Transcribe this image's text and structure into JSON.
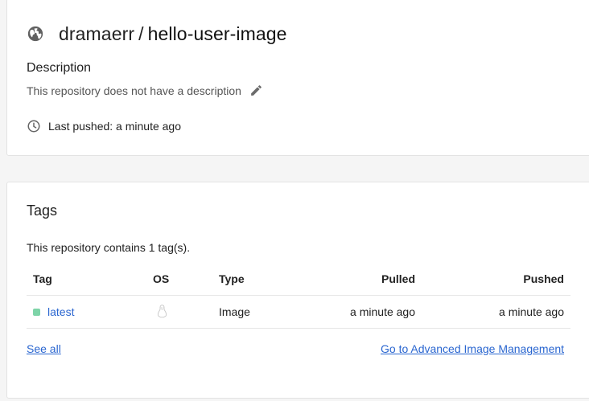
{
  "repo": {
    "owner": "dramaerr",
    "separator": "/",
    "image_name": "hello-user-image",
    "description_heading": "Description",
    "description_text": "This repository does not have a description",
    "last_pushed": "Last pushed: a minute ago"
  },
  "tags": {
    "title": "Tags",
    "summary": "This repository contains 1 tag(s).",
    "columns": {
      "tag": "Tag",
      "os": "OS",
      "type": "Type",
      "pulled": "Pulled",
      "pushed": "Pushed"
    },
    "rows": [
      {
        "tag": "latest",
        "os_icon": "linux-icon",
        "type": "Image",
        "pulled": "a minute ago",
        "pushed": "a minute ago",
        "status_color": "#7ed4a8"
      }
    ],
    "see_all": "See all",
    "advanced_link": "Go to Advanced Image Management"
  },
  "colors": {
    "link": "#2a66d0",
    "background": "#f5f5f5",
    "card": "#ffffff"
  },
  "icons": [
    "globe-icon",
    "pencil-icon",
    "clock-icon",
    "linux-icon"
  ]
}
